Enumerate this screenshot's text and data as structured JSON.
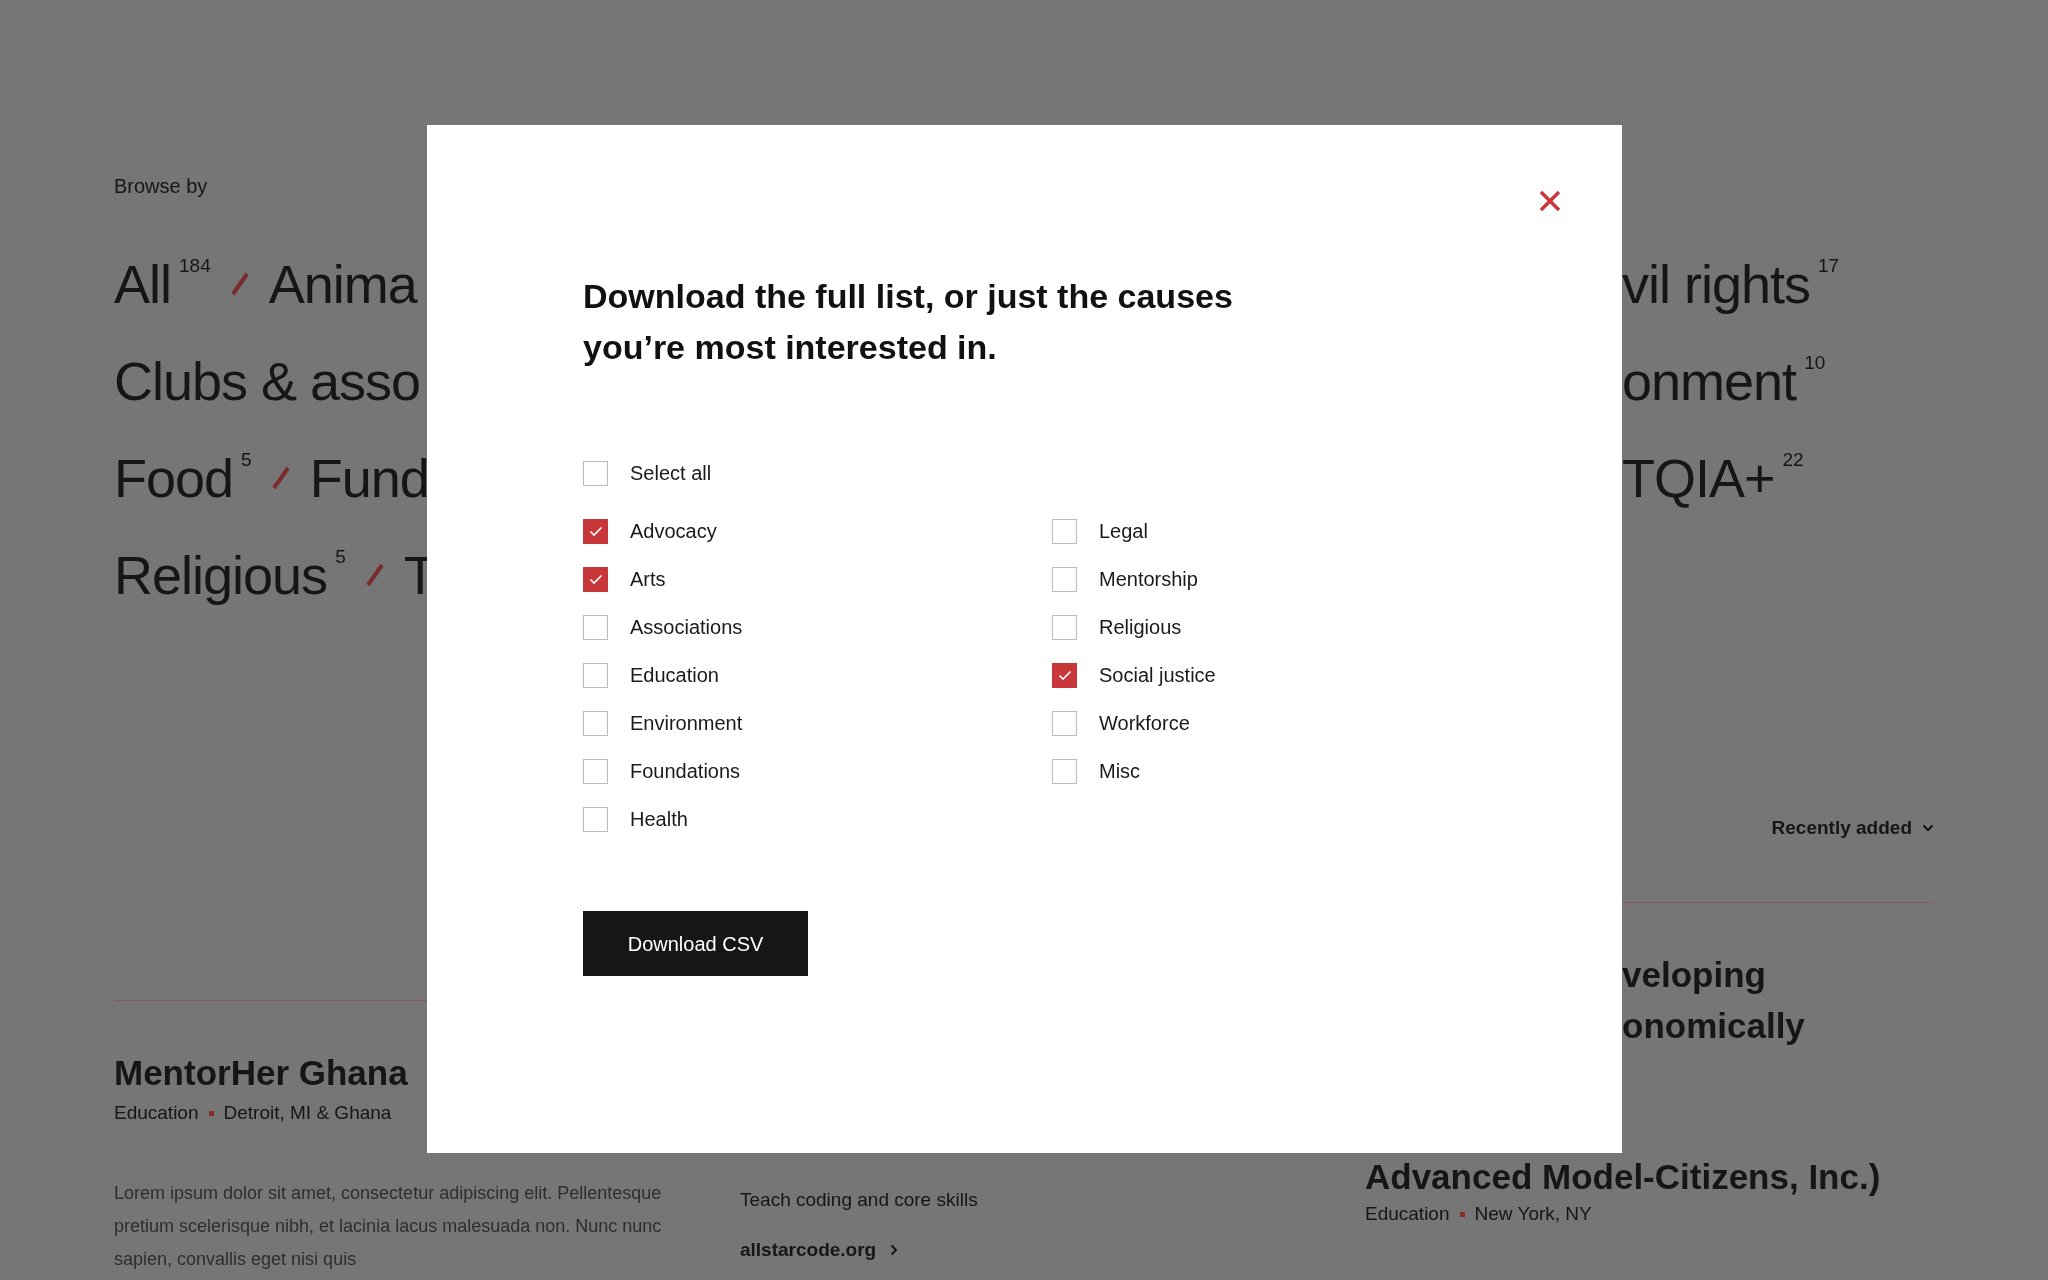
{
  "browse": {
    "label": "Browse by",
    "left_rows": [
      {
        "items": [
          {
            "label": "All",
            "count": "184"
          },
          {
            "label": "Anima"
          }
        ]
      },
      {
        "items": [
          {
            "label": "Clubs & asso"
          }
        ]
      },
      {
        "items": [
          {
            "label": "Food",
            "count": "5"
          },
          {
            "label": "Fund"
          }
        ]
      },
      {
        "items": [
          {
            "label": "Religious",
            "count": "5"
          },
          {
            "label": "T"
          }
        ]
      }
    ],
    "right_rows": [
      {
        "label": "vil rights",
        "count": "17"
      },
      {
        "label": "onment",
        "count": "10"
      },
      {
        "label": "TQIA+",
        "count": "22"
      }
    ]
  },
  "sort": {
    "label": "Recently added"
  },
  "listing_left": {
    "title": "MentorHer Ghana",
    "category": "Education",
    "location": "Detroit, MI & Ghana",
    "description": "Lorem ipsum dolor sit amet, consectetur adipiscing elit. Pellentesque pretium scelerisque nibh, et lacinia lacus malesuada non. Nunc nunc sapien, convallis eget nisi quis"
  },
  "listing_middle": {
    "description": "Teach coding and core skills",
    "link": "allstarcode.org"
  },
  "listing_right": {
    "title_lines": [
      "veloping",
      "onomically",
      "Advanced Model-Citizens, Inc.)"
    ],
    "category": "Education",
    "location": "New York, NY"
  },
  "modal": {
    "title": "Download the full list, or just the causes you’re most interested in.",
    "select_all": {
      "label": "Select all",
      "checked": false
    },
    "options_left": [
      {
        "label": "Advocacy",
        "checked": true
      },
      {
        "label": "Arts",
        "checked": true
      },
      {
        "label": "Associations",
        "checked": false
      },
      {
        "label": "Education",
        "checked": false
      },
      {
        "label": "Environment",
        "checked": false
      },
      {
        "label": "Foundations",
        "checked": false
      },
      {
        "label": "Health",
        "checked": false
      }
    ],
    "options_right": [
      {
        "label": "Legal",
        "checked": false
      },
      {
        "label": "Mentorship",
        "checked": false
      },
      {
        "label": "Religious",
        "checked": false
      },
      {
        "label": "Social justice",
        "checked": true
      },
      {
        "label": "Workforce",
        "checked": false
      },
      {
        "label": "Misc",
        "checked": false
      }
    ],
    "button": "Download CSV"
  }
}
